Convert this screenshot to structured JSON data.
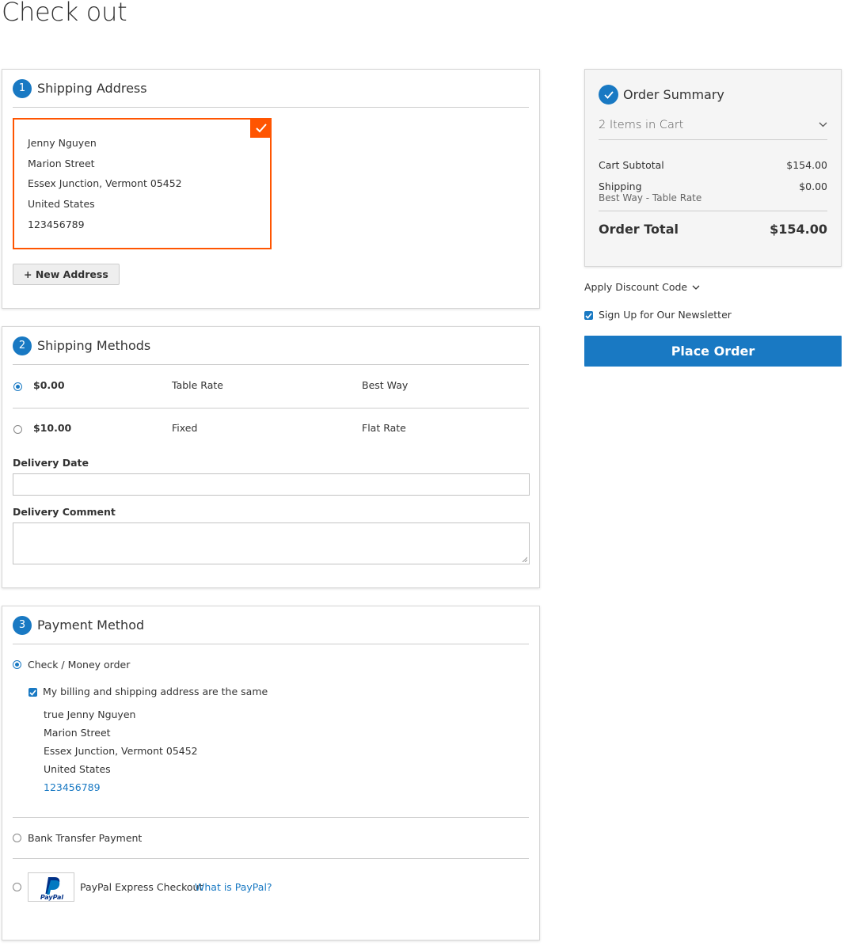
{
  "page": {
    "title": "Check out"
  },
  "shipping_address": {
    "step": "1",
    "title": "Shipping Address",
    "name": "Jenny Nguyen",
    "street": "Marion Street",
    "city_line": "Essex Junction, Vermont 05452",
    "country": "United States",
    "phone": "123456789",
    "new_address_label": "+ New Address"
  },
  "shipping_methods": {
    "step": "2",
    "title": "Shipping Methods",
    "rows": [
      {
        "price": "$0.00",
        "method": "Table Rate",
        "carrier": "Best Way",
        "selected": true
      },
      {
        "price": "$10.00",
        "method": "Fixed",
        "carrier": "Flat Rate",
        "selected": false
      }
    ],
    "delivery_date_label": "Delivery Date",
    "delivery_comment_label": "Delivery Comment"
  },
  "payment": {
    "step": "3",
    "title": "Payment Method",
    "options": [
      {
        "label": "Check / Money order",
        "selected": true
      },
      {
        "label": "Bank Transfer Payment",
        "selected": false
      },
      {
        "label": "PayPal Express Checkout",
        "selected": false
      }
    ],
    "same_address_label": "My billing and shipping address are the same",
    "billing": {
      "name": "true Jenny Nguyen",
      "street": "Marion Street",
      "city_line": "Essex Junction, Vermont 05452",
      "country": "United States",
      "phone": "123456789"
    },
    "paypal_logo_text": "PayPal",
    "paypal_link": "What is PayPal?"
  },
  "summary": {
    "title": "Order Summary",
    "items_in_cart": "2 Items in Cart",
    "subtotal_label": "Cart Subtotal",
    "subtotal_value": "$154.00",
    "shipping_label": "Shipping",
    "shipping_value": "$0.00",
    "shipping_sub": "Best Way - Table Rate",
    "total_label": "Order Total",
    "total_value": "$154.00"
  },
  "discount_label": "Apply Discount Code",
  "newsletter_label": "Sign Up for Our Newsletter",
  "place_order_label": "Place Order",
  "colors": {
    "accent": "#1979c3",
    "selected_border": "#ff5501"
  }
}
